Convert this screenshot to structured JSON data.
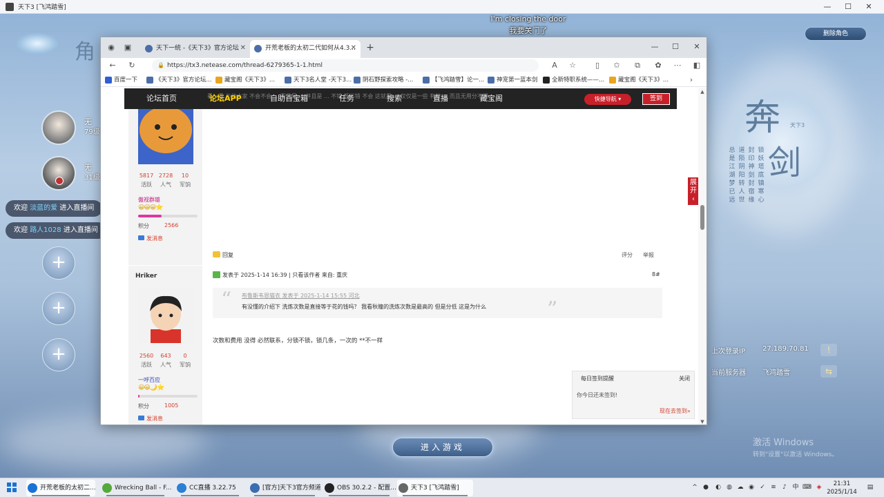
{
  "game": {
    "window_title": "天下3 [飞鸿踏雪]",
    "subtitle_en": "I'm closing the door",
    "subtitle_cn": "我要关门了",
    "delete_role_label": "删除角色",
    "characters": [
      {
        "name": "无",
        "level": "79级"
      },
      {
        "name": "无",
        "level": "31级"
      }
    ],
    "live_messages": [
      {
        "prefix": "欢迎",
        "user": "淡蓝的爱",
        "suffix": "进入直播间"
      },
      {
        "prefix": "欢迎",
        "user": "路人1028",
        "suffix": "进入直播间"
      }
    ],
    "add_char_glyph": "+",
    "logo_char1": "奔",
    "logo_char2": "剑",
    "logo_tag": "天下3",
    "poem_cols": [
      "锁妖塔底镇寒心",
      "封印神剑封宿缘",
      "道陨阴阳转人世",
      "总是江湖梦已远"
    ],
    "last_login_label": "上次登录IP",
    "last_login_value": "27.189.70.81",
    "server_label": "当前服务器",
    "server_value": "飞鸿踏雪",
    "enter_game_label": "进入游戏",
    "activate_windows_1": "激活 Windows",
    "activate_windows_2": "转到\"设置\"以激活 Windows。",
    "minimize_glyph": "—",
    "maximize_glyph": "☐",
    "close_glyph": "✕"
  },
  "browser": {
    "tabs": [
      {
        "label": "天下一统 -《天下3》官方论坛",
        "active": false
      },
      {
        "label": "开荒老板的太初二代如何从4.3...",
        "active": true
      }
    ],
    "new_tab_glyph": "+",
    "url": "https://tx3.netease.com/thread-6279365-1-1.html",
    "bookmarks": [
      "百度一下",
      "《天下3》官方论坛...",
      "藏宝阁《天下3》...",
      "天下3名人堂 -天下3...",
      "阴石野探索攻略 -...",
      "【飞鸿踏雪】论一...",
      "神宠第一蓝本剑",
      "全新特职系统——...",
      "藏宝阁《天下3》..."
    ]
  },
  "forum": {
    "nav": [
      "论坛首页",
      "论坛APP",
      "自助百宝箱",
      "任务",
      "搜索",
      "直播",
      "藏宝阁"
    ],
    "nav_ghost": "看一看 与他大家 不会不会 ... 而且是 ... 并且是 ... 不错 还不错 不会 这就是 ... 仅仅是一些 有效 ... 而且无用分不同",
    "quick_nav_label": "快捷导航 ▾",
    "checkin_label": "签到",
    "expand_label": "展开",
    "post1": {
      "stats": [
        {
          "n": "5817",
          "l": "活跃"
        },
        {
          "n": "2728",
          "l": "人气"
        },
        {
          "n": "10",
          "l": "军饷"
        }
      ],
      "rank": "傲视群雄",
      "medals": "😀😀😀⭐",
      "progress": 0.4,
      "score_label": "积分",
      "score": "2566",
      "message_label": "发消息",
      "reply_label": "回复",
      "rate_label": "评分",
      "report_label": "举报"
    },
    "post2": {
      "username": "Hriker",
      "stats": [
        {
          "n": "2560",
          "l": "活跃"
        },
        {
          "n": "643",
          "l": "人气"
        },
        {
          "n": "0",
          "l": "军饷"
        }
      ],
      "rank": "一呼百应",
      "medals": "😀😀🌙⭐",
      "progress": 0.02,
      "score_label": "积分",
      "score": "1005",
      "message_label": "发消息",
      "reply_label": "回复",
      "meta": "发表于 2025-1-14 16:39  |  只看该作者  来自: 重庆",
      "floor": "8#",
      "quote_head": "布鲁斯韦恩猫衣 发表于 2025-1-14 15:55 河北",
      "quote_text": "有没懂的介绍下 洗炼次数是直接等于花的钱吗？ 我看秋瞳的洗炼次数是最高的 但是分低 这是为什么",
      "body": "次数和费用 没得 必然联系，分锁不锁，锁几条，一次的 **不一样"
    },
    "checkin_popup": {
      "header": "每日签到提醒",
      "close": "关闭",
      "message": "你今日还未签到!",
      "go": "现在去签到»"
    }
  },
  "taskbar": {
    "items": [
      {
        "label": "开荒老板的太初二...",
        "active": true,
        "color": "#1a72d4"
      },
      {
        "label": "Wrecking Ball - F...",
        "active": false,
        "color": "#55a93b"
      },
      {
        "label": "CC直播 3.22.75",
        "active": false,
        "color": "#2b7fd4"
      },
      {
        "label": "[官方]天下3官方频道",
        "active": false,
        "color": "#3b6db0"
      },
      {
        "label": "OBS 30.2.2 - 配置...",
        "active": false,
        "color": "#222222"
      },
      {
        "label": "天下3 [飞鸿踏雪]",
        "active": true,
        "color": "#666666"
      }
    ],
    "time": "21:31",
    "date": "2025/1/14",
    "ime": "中"
  }
}
